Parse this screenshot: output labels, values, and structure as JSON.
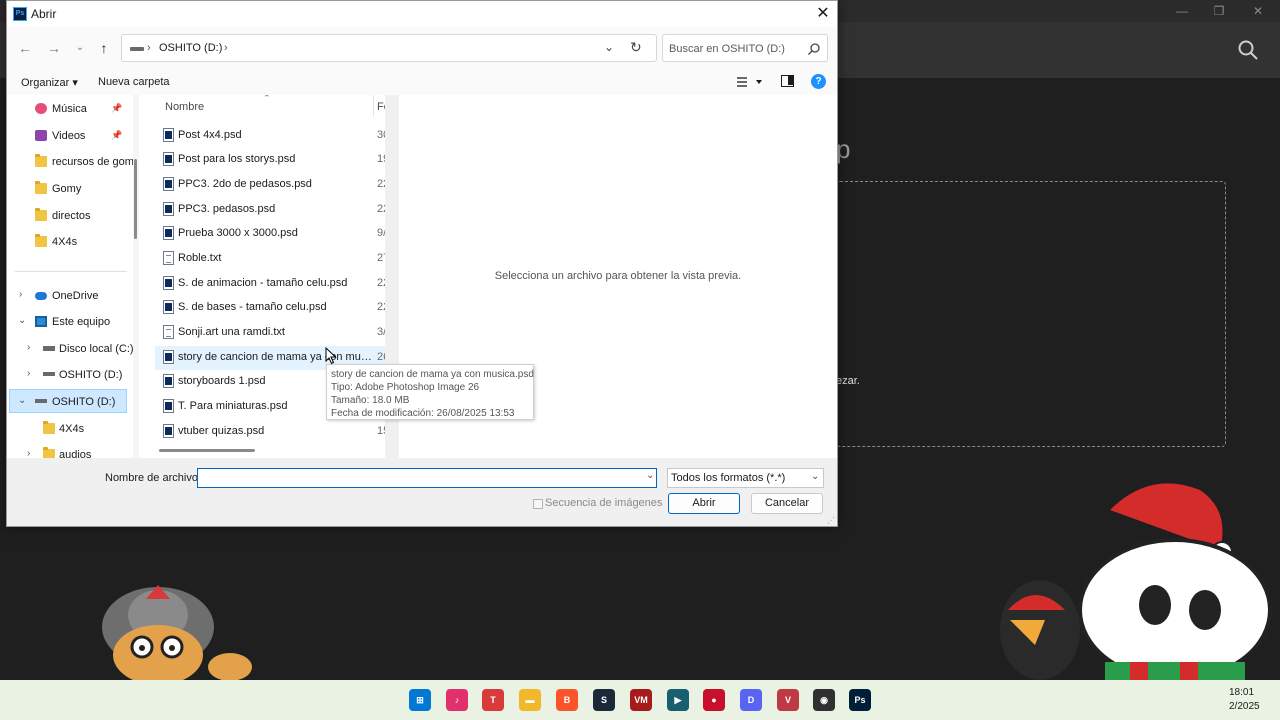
{
  "photoshop": {
    "home_title": "p",
    "dropzone_text": "ezar."
  },
  "dialog": {
    "title": "Abrir",
    "app_icon": "Ps",
    "close": "✕",
    "address": {
      "path": "OSHITO (D:)",
      "search_placeholder": "Buscar en OSHITO (D:)"
    },
    "toolbar": {
      "organize": "Organizar ▾",
      "new_folder": "Nueva carpeta",
      "help": "?"
    },
    "nav": [
      {
        "label": "Música",
        "icon": "music-icon",
        "pinned": true
      },
      {
        "label": "Videos",
        "icon": "videos-icon",
        "pinned": true
      },
      {
        "label": "recursos de gom",
        "icon": "folder-icon"
      },
      {
        "label": "Gomy",
        "icon": "folder-icon"
      },
      {
        "label": "directos",
        "icon": "folder-icon"
      },
      {
        "label": "4X4s",
        "icon": "folder-icon"
      },
      {
        "label": "OneDrive",
        "icon": "onedrive-icon"
      },
      {
        "label": "Este equipo",
        "icon": "computer-icon"
      },
      {
        "label": "Disco local (C:)",
        "icon": "local-disk-icon"
      },
      {
        "label": "OSHITO (D:)",
        "icon": "drive-icon"
      },
      {
        "label": "OSHITO (D:)",
        "icon": "drive-icon",
        "selected": true
      },
      {
        "label": "4X4s",
        "icon": "folder-icon"
      },
      {
        "label": "audios",
        "icon": "folder-icon"
      }
    ],
    "columns": {
      "name": "Nombre",
      "date": "Fe"
    },
    "files": [
      {
        "name": "Post 4x4.psd",
        "type": "psd",
        "date": "30"
      },
      {
        "name": "Post para los storys.psd",
        "type": "psd",
        "date": "19"
      },
      {
        "name": "PPC3. 2do de pedasos.psd",
        "type": "psd",
        "date": "22"
      },
      {
        "name": "PPC3. pedasos.psd",
        "type": "psd",
        "date": "22"
      },
      {
        "name": "Prueba 3000 x 3000.psd",
        "type": "psd",
        "date": "9/"
      },
      {
        "name": "Roble.txt",
        "type": "txt",
        "date": "27"
      },
      {
        "name": "S. de animacion - tamaño celu.psd",
        "type": "psd",
        "date": "22"
      },
      {
        "name": "S. de bases - tamaño celu.psd",
        "type": "psd",
        "date": "22"
      },
      {
        "name": "Sonji.art una ramdi.txt",
        "type": "txt",
        "date": "3/"
      },
      {
        "name": "story de cancion de mama ya con musica...",
        "type": "psd",
        "date": "26",
        "hover": true
      },
      {
        "name": "storyboards 1.psd",
        "type": "psd",
        "date": ""
      },
      {
        "name": "T. Para miniaturas.psd",
        "type": "psd",
        "date": ""
      },
      {
        "name": "vtuber quizas.psd",
        "type": "psd",
        "date": "15"
      }
    ],
    "tooltip": {
      "line1": "story de cancion de mama ya con musica.psd",
      "line2": "Tipo: Adobe Photoshop Image 26",
      "line3": "Tamaño: 18.0 MB",
      "line4": "Fecha de modificación: 26/08/2025 13:53"
    },
    "preview_text": "Selecciona un archivo para obtener la vista previa.",
    "filename_label": "Nombre de archivo:",
    "filename_value": "",
    "filetype": "Todos los formatos (*.*)",
    "sequence_label": "Secuencia de imágenes",
    "open_button": "Abrir",
    "cancel_button": "Cancelar"
  },
  "taskbar": {
    "time": "18:01",
    "date": "2/2025",
    "apps": [
      {
        "name": "start",
        "color": "#0078d4",
        "glyph": "⊞"
      },
      {
        "name": "tiktok",
        "color": "#e1306c",
        "glyph": "♪"
      },
      {
        "name": "typedesk",
        "color": "#d93a3a",
        "glyph": "T"
      },
      {
        "name": "file-explorer",
        "color": "#f2b72b",
        "glyph": "▬"
      },
      {
        "name": "brave",
        "color": "#fb542b",
        "glyph": "B"
      },
      {
        "name": "steam",
        "color": "#1b2838",
        "glyph": "S"
      },
      {
        "name": "voicemeeter",
        "color": "#a61b1b",
        "glyph": "VM"
      },
      {
        "name": "capcut",
        "color": "#1a5f6f",
        "glyph": "▶"
      },
      {
        "name": "red-app",
        "color": "#c8102e",
        "glyph": "●"
      },
      {
        "name": "discord",
        "color": "#5865f2",
        "glyph": "D"
      },
      {
        "name": "valorant",
        "color": "#bd3944",
        "glyph": "V"
      },
      {
        "name": "obs",
        "color": "#303030",
        "glyph": "◉"
      },
      {
        "name": "photoshop",
        "color": "#001e36",
        "glyph": "Ps"
      }
    ]
  }
}
